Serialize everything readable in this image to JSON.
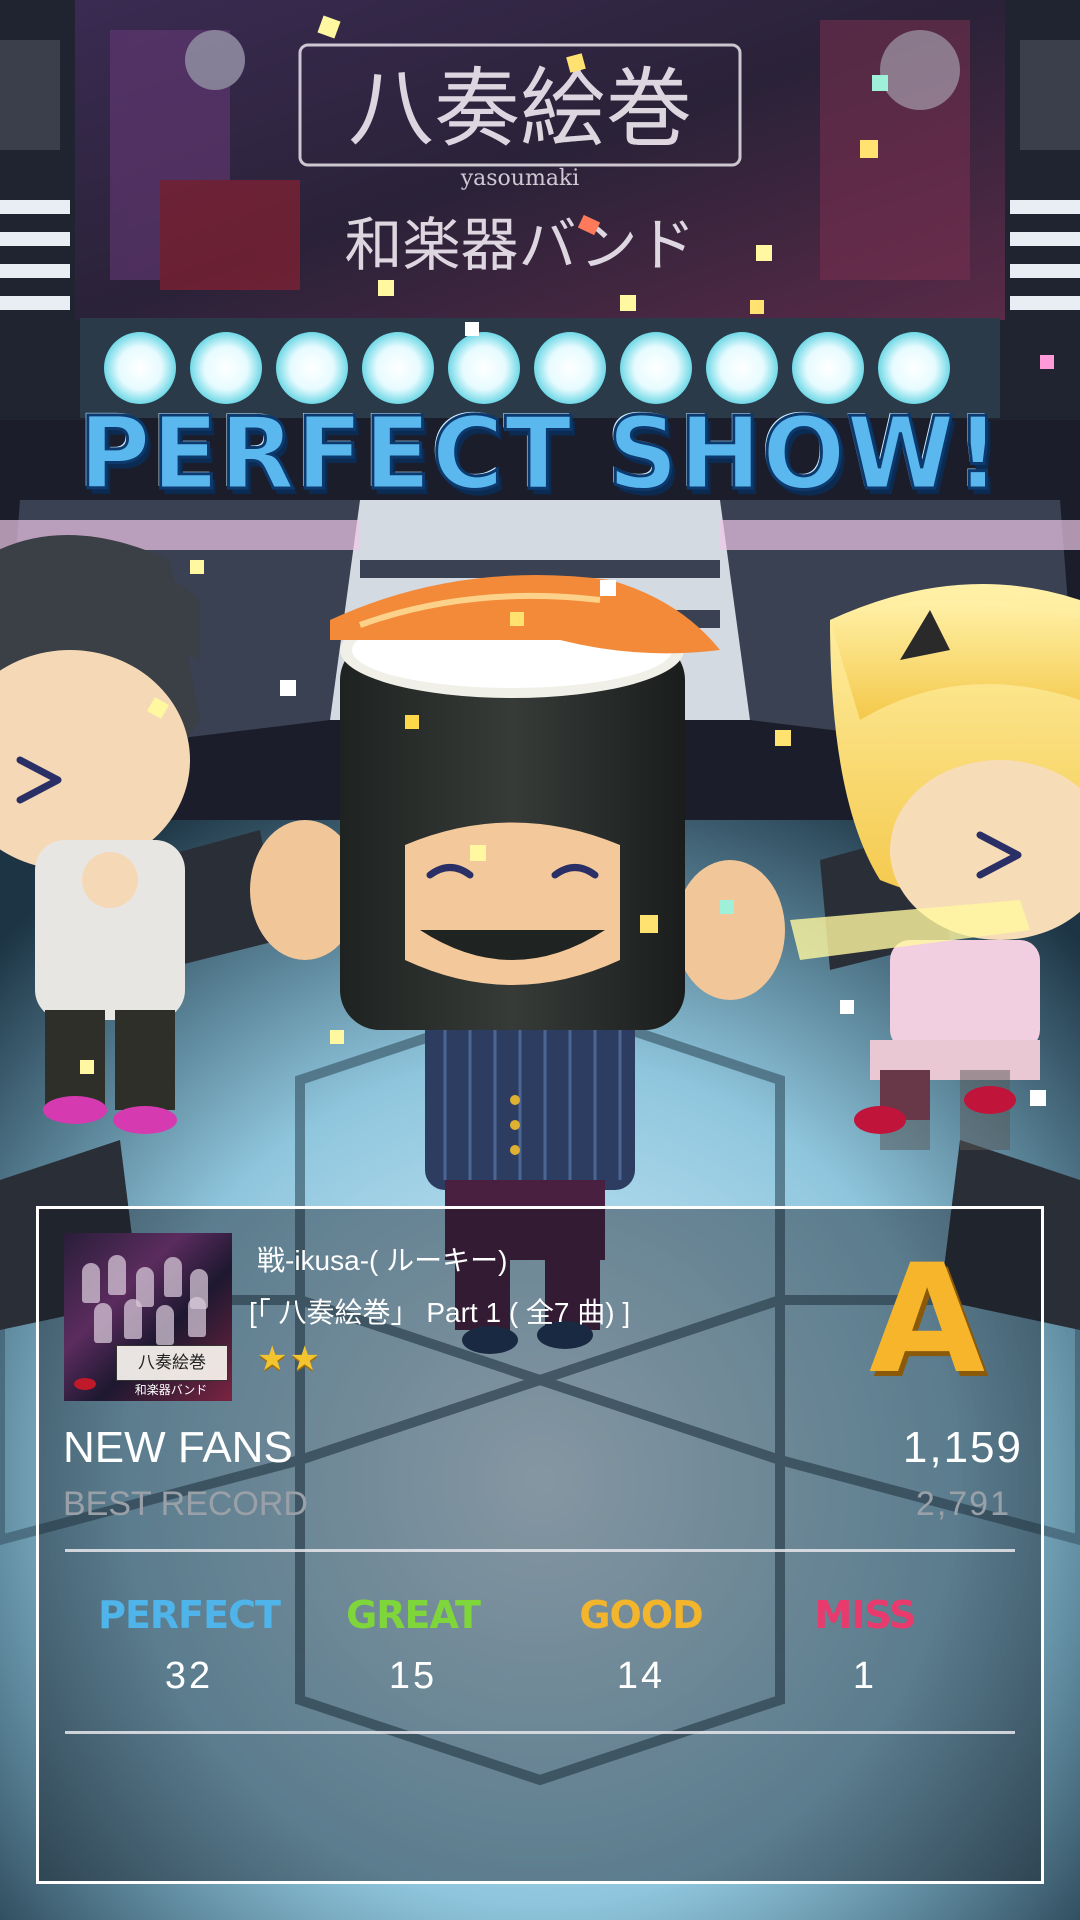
{
  "result_title": "PERFECT SHOW!",
  "song": {
    "title": "戦-ikusa-( ルーキー)",
    "album": "[「 八奏絵巻」 Part 1 ( 全7 曲) ]",
    "stars": "★★",
    "star_count": 2,
    "rank": "A"
  },
  "jacket": {
    "band_title": "八奏絵巻",
    "band_name": "和楽器バンド"
  },
  "backdrop": {
    "banner_title": "八奏絵巻",
    "banner_sub": "yasoumaki",
    "banner_band": "和楽器バンド"
  },
  "fans": {
    "label": "NEW FANS",
    "value": "1,159",
    "best_label": "BEST RECORD",
    "best_value": "2,791"
  },
  "judgements": [
    {
      "label": "PERFECT",
      "count": "32",
      "color": "#4fb4ea"
    },
    {
      "label": "GREAT",
      "count": "15",
      "color": "#7fd63a"
    },
    {
      "label": "GOOD",
      "count": "14",
      "color": "#f3b52c"
    },
    {
      "label": "MISS",
      "count": "1",
      "color": "#e83a6c"
    }
  ]
}
